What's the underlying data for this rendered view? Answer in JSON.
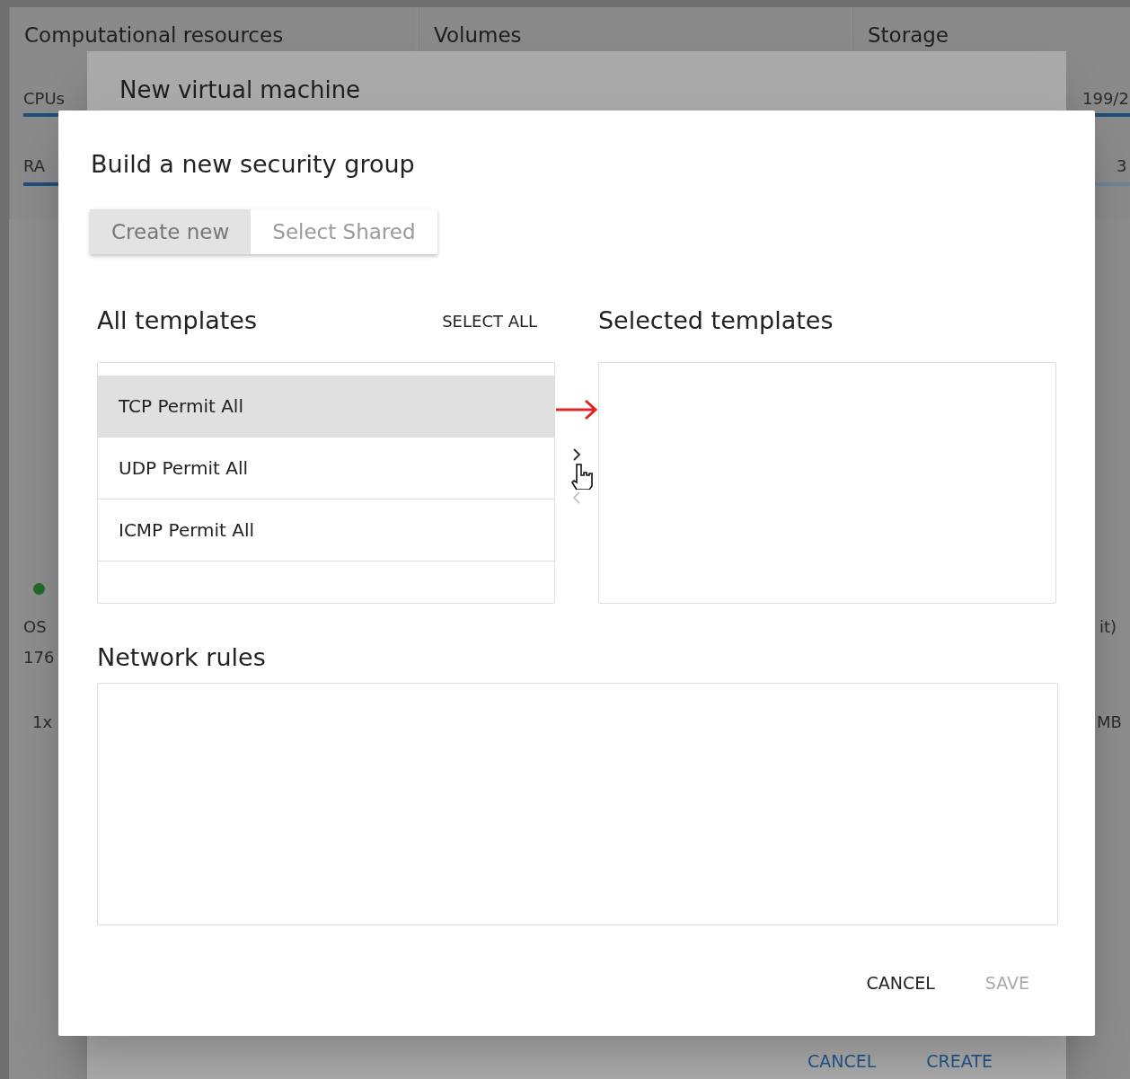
{
  "background": {
    "cards": [
      {
        "title": "Computational resources"
      },
      {
        "title": "Volumes"
      },
      {
        "title": "Storage"
      }
    ],
    "labels": [
      {
        "text": "CPUs"
      },
      {
        "text": "RA"
      },
      {
        "text": "199/2"
      },
      {
        "text": "3"
      },
      {
        "text": "OS"
      },
      {
        "text": "176"
      },
      {
        "text": "1x"
      },
      {
        "text": "it)"
      },
      {
        "text": "MB"
      }
    ],
    "status_dot": {
      "color": "#1f6b2a"
    }
  },
  "vm_dialog": {
    "title": "New virtual machine",
    "buttons": [
      {
        "label": "CANCEL"
      },
      {
        "label": "CREATE"
      }
    ]
  },
  "security_dialog": {
    "title": "Build a new security group",
    "tabs": [
      {
        "label": "Create new",
        "selected": true
      },
      {
        "label": "Select Shared",
        "selected": false
      }
    ],
    "all_templates": {
      "heading": "All templates",
      "select_all": "SELECT ALL",
      "items": [
        {
          "label": "TCP Permit All",
          "selected": true
        },
        {
          "label": "UDP Permit All",
          "selected": false
        },
        {
          "label": "ICMP Permit All",
          "selected": false
        }
      ]
    },
    "transfer": [
      {
        "kind": "right",
        "disabled": false
      },
      {
        "kind": "left",
        "disabled": true
      }
    ],
    "selected_templates": {
      "heading": "Selected templates"
    },
    "network_rules": {
      "heading": "Network rules"
    },
    "actions": [
      {
        "label": "CANCEL",
        "disabled": false
      },
      {
        "label": "SAVE",
        "disabled": true
      }
    ]
  }
}
